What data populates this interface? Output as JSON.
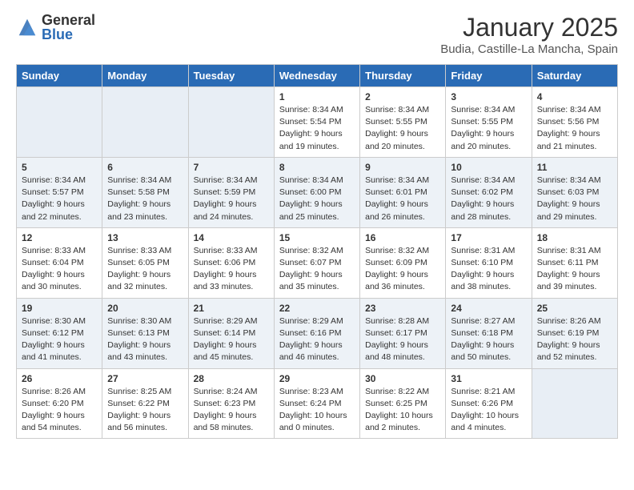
{
  "header": {
    "logo_general": "General",
    "logo_blue": "Blue",
    "month_title": "January 2025",
    "location": "Budia, Castille-La Mancha, Spain"
  },
  "days_of_week": [
    "Sunday",
    "Monday",
    "Tuesday",
    "Wednesday",
    "Thursday",
    "Friday",
    "Saturday"
  ],
  "weeks": [
    [
      {
        "day": "",
        "empty": true
      },
      {
        "day": "",
        "empty": true
      },
      {
        "day": "",
        "empty": true
      },
      {
        "day": "1",
        "sunrise": "8:34 AM",
        "sunset": "5:54 PM",
        "daylight": "9 hours and 19 minutes."
      },
      {
        "day": "2",
        "sunrise": "8:34 AM",
        "sunset": "5:55 PM",
        "daylight": "9 hours and 20 minutes."
      },
      {
        "day": "3",
        "sunrise": "8:34 AM",
        "sunset": "5:55 PM",
        "daylight": "9 hours and 20 minutes."
      },
      {
        "day": "4",
        "sunrise": "8:34 AM",
        "sunset": "5:56 PM",
        "daylight": "9 hours and 21 minutes."
      }
    ],
    [
      {
        "day": "5",
        "sunrise": "8:34 AM",
        "sunset": "5:57 PM",
        "daylight": "9 hours and 22 minutes."
      },
      {
        "day": "6",
        "sunrise": "8:34 AM",
        "sunset": "5:58 PM",
        "daylight": "9 hours and 23 minutes."
      },
      {
        "day": "7",
        "sunrise": "8:34 AM",
        "sunset": "5:59 PM",
        "daylight": "9 hours and 24 minutes."
      },
      {
        "day": "8",
        "sunrise": "8:34 AM",
        "sunset": "6:00 PM",
        "daylight": "9 hours and 25 minutes."
      },
      {
        "day": "9",
        "sunrise": "8:34 AM",
        "sunset": "6:01 PM",
        "daylight": "9 hours and 26 minutes."
      },
      {
        "day": "10",
        "sunrise": "8:34 AM",
        "sunset": "6:02 PM",
        "daylight": "9 hours and 28 minutes."
      },
      {
        "day": "11",
        "sunrise": "8:34 AM",
        "sunset": "6:03 PM",
        "daylight": "9 hours and 29 minutes."
      }
    ],
    [
      {
        "day": "12",
        "sunrise": "8:33 AM",
        "sunset": "6:04 PM",
        "daylight": "9 hours and 30 minutes."
      },
      {
        "day": "13",
        "sunrise": "8:33 AM",
        "sunset": "6:05 PM",
        "daylight": "9 hours and 32 minutes."
      },
      {
        "day": "14",
        "sunrise": "8:33 AM",
        "sunset": "6:06 PM",
        "daylight": "9 hours and 33 minutes."
      },
      {
        "day": "15",
        "sunrise": "8:32 AM",
        "sunset": "6:07 PM",
        "daylight": "9 hours and 35 minutes."
      },
      {
        "day": "16",
        "sunrise": "8:32 AM",
        "sunset": "6:09 PM",
        "daylight": "9 hours and 36 minutes."
      },
      {
        "day": "17",
        "sunrise": "8:31 AM",
        "sunset": "6:10 PM",
        "daylight": "9 hours and 38 minutes."
      },
      {
        "day": "18",
        "sunrise": "8:31 AM",
        "sunset": "6:11 PM",
        "daylight": "9 hours and 39 minutes."
      }
    ],
    [
      {
        "day": "19",
        "sunrise": "8:30 AM",
        "sunset": "6:12 PM",
        "daylight": "9 hours and 41 minutes."
      },
      {
        "day": "20",
        "sunrise": "8:30 AM",
        "sunset": "6:13 PM",
        "daylight": "9 hours and 43 minutes."
      },
      {
        "day": "21",
        "sunrise": "8:29 AM",
        "sunset": "6:14 PM",
        "daylight": "9 hours and 45 minutes."
      },
      {
        "day": "22",
        "sunrise": "8:29 AM",
        "sunset": "6:16 PM",
        "daylight": "9 hours and 46 minutes."
      },
      {
        "day": "23",
        "sunrise": "8:28 AM",
        "sunset": "6:17 PM",
        "daylight": "9 hours and 48 minutes."
      },
      {
        "day": "24",
        "sunrise": "8:27 AM",
        "sunset": "6:18 PM",
        "daylight": "9 hours and 50 minutes."
      },
      {
        "day": "25",
        "sunrise": "8:26 AM",
        "sunset": "6:19 PM",
        "daylight": "9 hours and 52 minutes."
      }
    ],
    [
      {
        "day": "26",
        "sunrise": "8:26 AM",
        "sunset": "6:20 PM",
        "daylight": "9 hours and 54 minutes."
      },
      {
        "day": "27",
        "sunrise": "8:25 AM",
        "sunset": "6:22 PM",
        "daylight": "9 hours and 56 minutes."
      },
      {
        "day": "28",
        "sunrise": "8:24 AM",
        "sunset": "6:23 PM",
        "daylight": "9 hours and 58 minutes."
      },
      {
        "day": "29",
        "sunrise": "8:23 AM",
        "sunset": "6:24 PM",
        "daylight": "10 hours and 0 minutes."
      },
      {
        "day": "30",
        "sunrise": "8:22 AM",
        "sunset": "6:25 PM",
        "daylight": "10 hours and 2 minutes."
      },
      {
        "day": "31",
        "sunrise": "8:21 AM",
        "sunset": "6:26 PM",
        "daylight": "10 hours and 4 minutes."
      },
      {
        "day": "",
        "empty": true
      }
    ]
  ],
  "labels": {
    "sunrise": "Sunrise:",
    "sunset": "Sunset:",
    "daylight": "Daylight hours"
  }
}
